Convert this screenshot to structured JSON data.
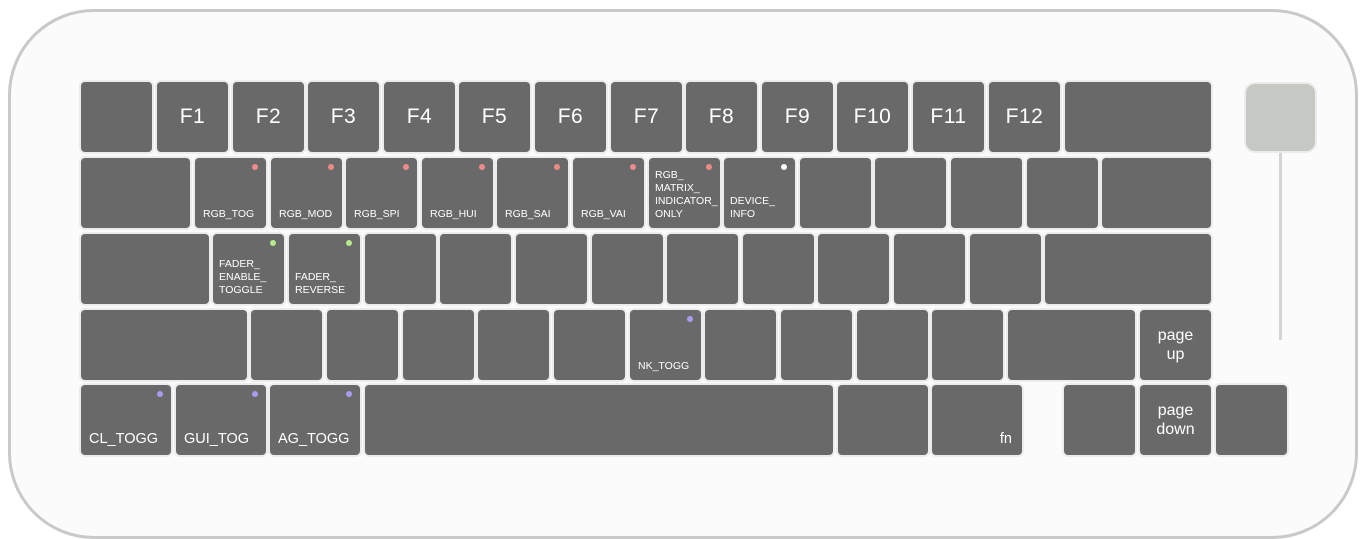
{
  "keyboard": {
    "row_fn": {
      "f1": "F1",
      "f2": "F2",
      "f3": "F3",
      "f4": "F4",
      "f5": "F5",
      "f6": "F6",
      "f7": "F7",
      "f8": "F8",
      "f9": "F9",
      "f10": "F10",
      "f11": "F11",
      "f12": "F12"
    },
    "row_rgb": {
      "rgb_tog": "RGB_TOG",
      "rgb_mod": "RGB_MOD",
      "rgb_spi": "RGB_SPI",
      "rgb_hui": "RGB_HUI",
      "rgb_sai": "RGB_SAI",
      "rgb_vai": "RGB_VAI",
      "rgb_matrix": "RGB_\nMATRIX_\nINDICATOR_\nONLY",
      "device_info": "DEVICE_\nINFO"
    },
    "row_fader": {
      "fader_enable": "FADER_\nENABLE_\nTOGGLE",
      "fader_reverse": "FADER_\nREVERSE"
    },
    "row_shift": {
      "nk_togg": "NK_TOGG",
      "page_up": "page\nup"
    },
    "row_bottom": {
      "cl_togg": "CL_TOGG",
      "gui_tog": "GUI_TOG",
      "ag_togg": "AG_TOGG",
      "fn": "fn",
      "page_down": "page\ndown"
    }
  },
  "indicator_colors": {
    "rgb": "#ef8a8a",
    "device": "#ffffff",
    "fader": "#b6e88c",
    "system": "#a99cf0"
  },
  "colors": {
    "key": "#696969",
    "case_border": "#c9c9c9",
    "fader_knob": "#c6c8c3"
  }
}
